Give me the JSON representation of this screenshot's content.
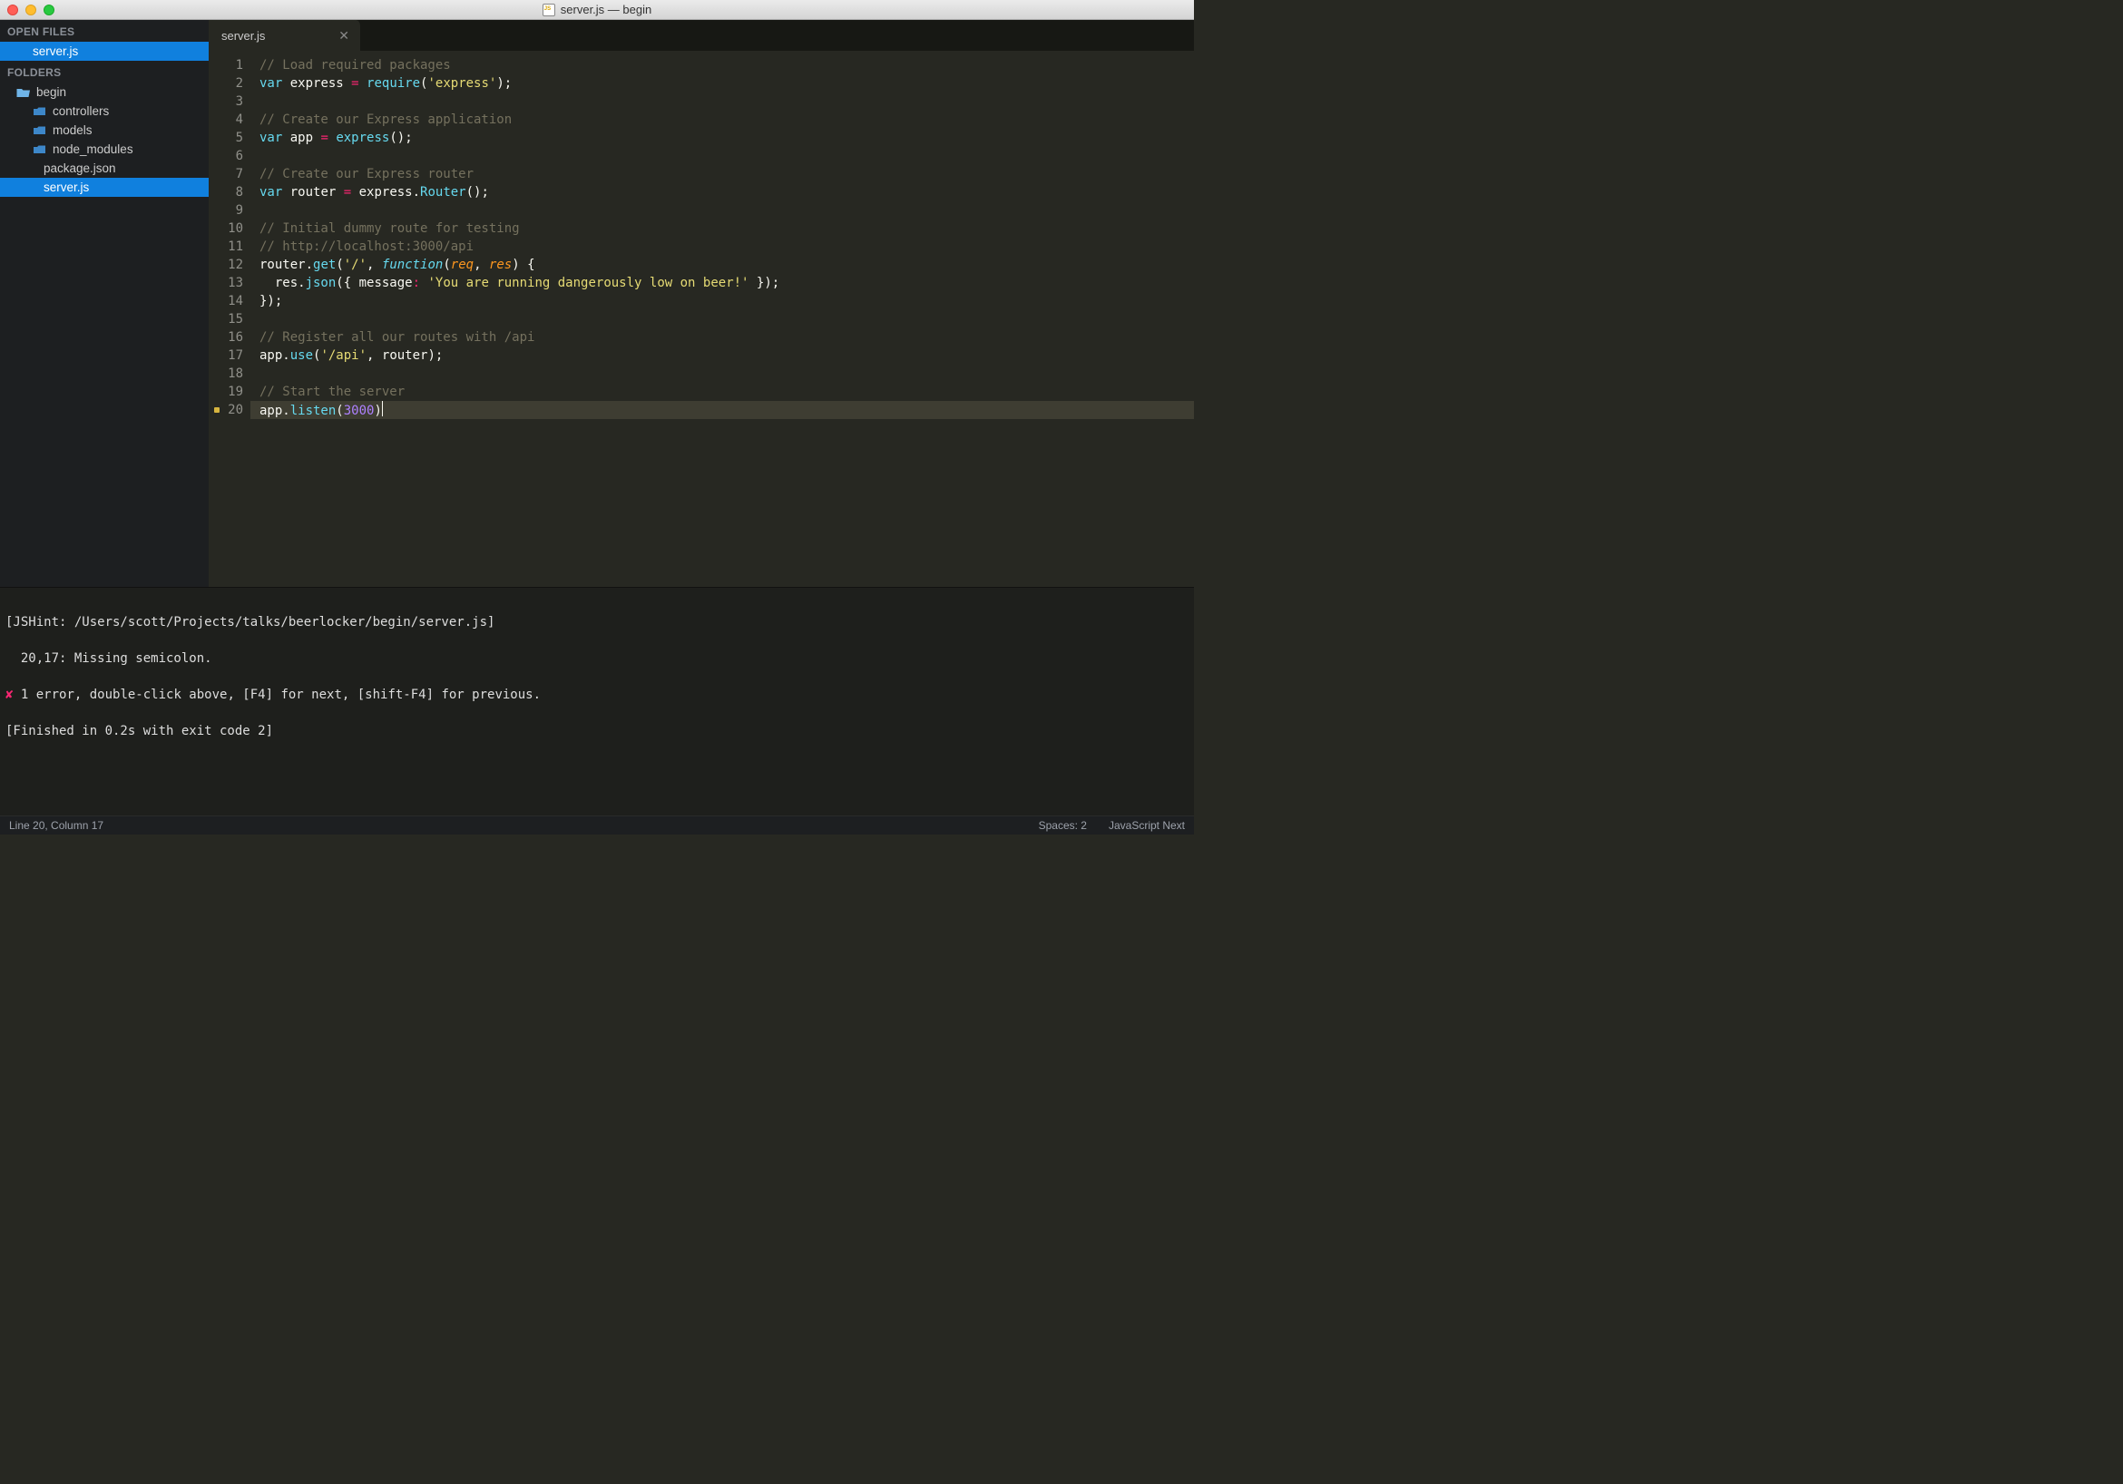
{
  "window": {
    "title": "server.js — begin"
  },
  "sidebar": {
    "open_files_header": "OPEN FILES",
    "open_files": [
      {
        "label": "server.js",
        "selected": true
      }
    ],
    "folders_header": "FOLDERS",
    "tree": {
      "root": {
        "label": "begin"
      },
      "children": [
        {
          "label": "controllers",
          "type": "folder"
        },
        {
          "label": "models",
          "type": "folder"
        },
        {
          "label": "node_modules",
          "type": "folder"
        },
        {
          "label": "package.json",
          "type": "file"
        },
        {
          "label": "server.js",
          "type": "file",
          "selected": true
        }
      ]
    }
  },
  "tabs": [
    {
      "label": "server.js",
      "active": true
    }
  ],
  "code": {
    "lines": [
      {
        "n": 1,
        "tokens": [
          [
            "c-comment",
            "// Load required packages"
          ]
        ]
      },
      {
        "n": 2,
        "tokens": [
          [
            "c-keyword-nf",
            "var"
          ],
          [
            "c-plain",
            " express "
          ],
          [
            "c-op",
            "="
          ],
          [
            "c-plain",
            " "
          ],
          [
            "c-call",
            "require"
          ],
          [
            "c-plain",
            "("
          ],
          [
            "c-string",
            "'express'"
          ],
          [
            "c-plain",
            ");"
          ]
        ]
      },
      {
        "n": 3,
        "tokens": []
      },
      {
        "n": 4,
        "tokens": [
          [
            "c-comment",
            "// Create our Express application"
          ]
        ]
      },
      {
        "n": 5,
        "tokens": [
          [
            "c-keyword-nf",
            "var"
          ],
          [
            "c-plain",
            " app "
          ],
          [
            "c-op",
            "="
          ],
          [
            "c-plain",
            " "
          ],
          [
            "c-call",
            "express"
          ],
          [
            "c-plain",
            "();"
          ]
        ]
      },
      {
        "n": 6,
        "tokens": []
      },
      {
        "n": 7,
        "tokens": [
          [
            "c-comment",
            "// Create our Express router"
          ]
        ]
      },
      {
        "n": 8,
        "tokens": [
          [
            "c-keyword-nf",
            "var"
          ],
          [
            "c-plain",
            " router "
          ],
          [
            "c-op",
            "="
          ],
          [
            "c-plain",
            " express."
          ],
          [
            "c-call",
            "Router"
          ],
          [
            "c-plain",
            "();"
          ]
        ]
      },
      {
        "n": 9,
        "tokens": []
      },
      {
        "n": 10,
        "tokens": [
          [
            "c-comment",
            "// Initial dummy route for testing"
          ]
        ]
      },
      {
        "n": 11,
        "tokens": [
          [
            "c-comment",
            "// http://localhost:3000/api"
          ]
        ]
      },
      {
        "n": 12,
        "tokens": [
          [
            "c-plain",
            "router."
          ],
          [
            "c-call",
            "get"
          ],
          [
            "c-plain",
            "("
          ],
          [
            "c-string",
            "'/'"
          ],
          [
            "c-plain",
            ", "
          ],
          [
            "c-funckw",
            "function"
          ],
          [
            "c-plain",
            "("
          ],
          [
            "c-param",
            "req"
          ],
          [
            "c-plain",
            ", "
          ],
          [
            "c-param",
            "res"
          ],
          [
            "c-plain",
            ") {"
          ]
        ]
      },
      {
        "n": 13,
        "tokens": [
          [
            "c-plain",
            "  res."
          ],
          [
            "c-call",
            "json"
          ],
          [
            "c-plain",
            "({ message"
          ],
          [
            "c-op",
            ":"
          ],
          [
            "c-plain",
            " "
          ],
          [
            "c-string",
            "'You are running dangerously low on beer!'"
          ],
          [
            "c-plain",
            " });"
          ]
        ]
      },
      {
        "n": 14,
        "tokens": [
          [
            "c-plain",
            "});"
          ]
        ]
      },
      {
        "n": 15,
        "tokens": []
      },
      {
        "n": 16,
        "tokens": [
          [
            "c-comment",
            "// Register all our routes with /api"
          ]
        ]
      },
      {
        "n": 17,
        "tokens": [
          [
            "c-plain",
            "app."
          ],
          [
            "c-call",
            "use"
          ],
          [
            "c-plain",
            "("
          ],
          [
            "c-string",
            "'/api'"
          ],
          [
            "c-plain",
            ", router);"
          ]
        ]
      },
      {
        "n": 18,
        "tokens": []
      },
      {
        "n": 19,
        "tokens": [
          [
            "c-comment",
            "// Start the server"
          ]
        ]
      },
      {
        "n": 20,
        "lint": true,
        "current": true,
        "tokens": [
          [
            "c-plain",
            "app."
          ],
          [
            "c-call",
            "listen"
          ],
          [
            "c-plain",
            "("
          ],
          [
            "c-number",
            "3000"
          ],
          [
            "c-plain",
            ")"
          ]
        ]
      }
    ]
  },
  "console": {
    "line1": "[JSHint: /Users/scott/Projects/talks/beerlocker/begin/server.js]",
    "line2": "  20,17: Missing semicolon.",
    "err_x": "✘",
    "line3": " 1 error, double-click above, [F4] for next, [shift-F4] for previous.",
    "line4": "[Finished in 0.2s with exit code 2]"
  },
  "statusbar": {
    "position": "Line 20, Column 17",
    "spaces": "Spaces: 2",
    "syntax": "JavaScript Next"
  }
}
